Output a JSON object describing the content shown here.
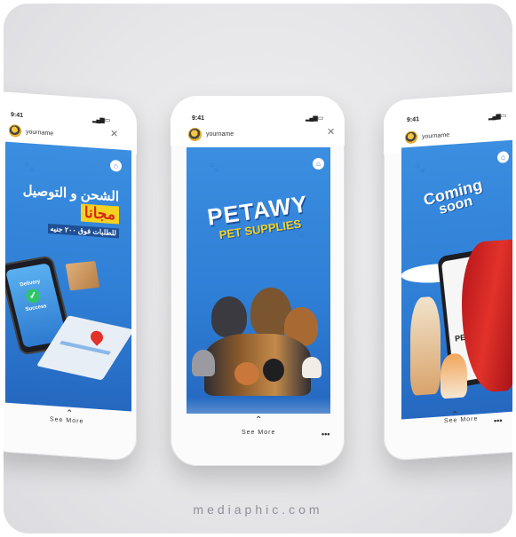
{
  "status_time": "9:41",
  "username": "yourname",
  "see_more": "See More",
  "more_glyph": "•••",
  "close_glyph": "✕",
  "chevron_glyph": "⌃",
  "watermark": "mediaphic.com",
  "left_story": {
    "arabic_line1": "الشحن و التوصيل",
    "arabic_line2": "مجانا",
    "arabic_line3": "للطلبات فوق ٢٠٠ جنيه",
    "badge_line1": "Delivery",
    "badge_line2": "Success"
  },
  "center_story": {
    "brand": "PETAWY",
    "tagline": "PET SUPPLIES"
  },
  "right_story": {
    "line1": "Coming",
    "line2": "soon",
    "phone_brand": "PETAW"
  },
  "colors": {
    "story_blue": "#2f7fd6",
    "accent_yellow": "#f4d21f",
    "accent_red": "#d8261c"
  }
}
